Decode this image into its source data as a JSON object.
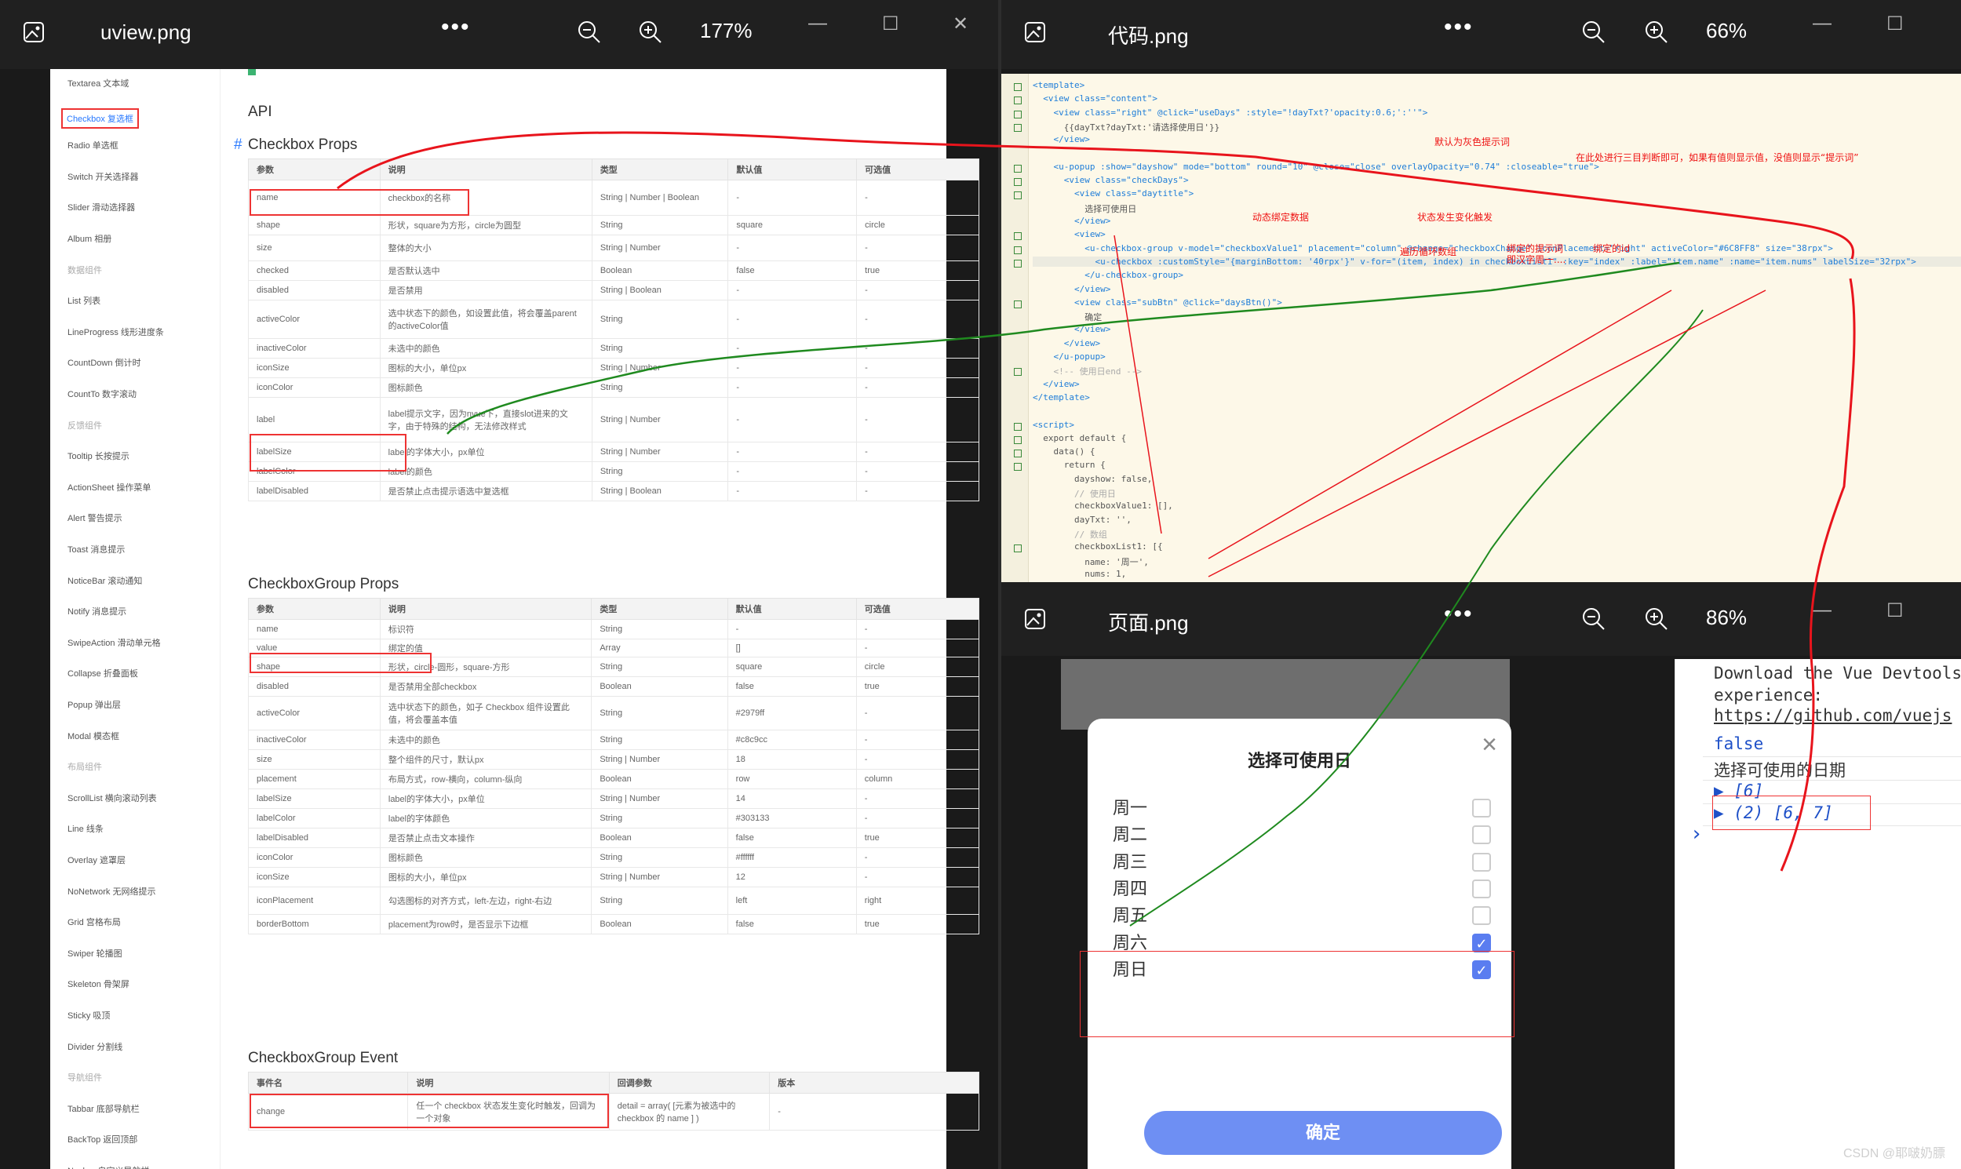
{
  "windows": {
    "uview": {
      "title": "uview.png",
      "zoom": "177%",
      "more": "•••"
    },
    "code": {
      "title": "代码.png",
      "zoom": "66%",
      "more": "•••"
    },
    "page": {
      "title": "页面.png",
      "zoom": "86%",
      "more": "•••"
    }
  },
  "uview_doc": {
    "sidebar": [
      {
        "label": "Textarea 文本域",
        "kind": "item"
      },
      {
        "label": "Checkbox 复选框",
        "kind": "active"
      },
      {
        "label": "Radio 单选框",
        "kind": "item"
      },
      {
        "label": "Switch 开关选择器",
        "kind": "item"
      },
      {
        "label": "Slider 滑动选择器",
        "kind": "item"
      },
      {
        "label": "Album 相册",
        "kind": "item"
      },
      {
        "label": "数据组件",
        "kind": "group"
      },
      {
        "label": "List 列表",
        "kind": "item"
      },
      {
        "label": "LineProgress 线形进度条",
        "kind": "item"
      },
      {
        "label": "CountDown 倒计时",
        "kind": "item"
      },
      {
        "label": "CountTo 数字滚动",
        "kind": "item"
      },
      {
        "label": "反馈组件",
        "kind": "group"
      },
      {
        "label": "Tooltip 长按提示",
        "kind": "item"
      },
      {
        "label": "ActionSheet 操作菜单",
        "kind": "item"
      },
      {
        "label": "Alert 警告提示",
        "kind": "item"
      },
      {
        "label": "Toast 消息提示",
        "kind": "item"
      },
      {
        "label": "NoticeBar 滚动通知",
        "kind": "item"
      },
      {
        "label": "Notify 消息提示",
        "kind": "item"
      },
      {
        "label": "SwipeAction 滑动单元格",
        "kind": "item"
      },
      {
        "label": "Collapse 折叠面板",
        "kind": "item"
      },
      {
        "label": "Popup 弹出层",
        "kind": "item"
      },
      {
        "label": "Modal 模态框",
        "kind": "item"
      },
      {
        "label": "布局组件",
        "kind": "group"
      },
      {
        "label": "ScrollList 横向滚动列表",
        "kind": "item"
      },
      {
        "label": "Line 线条",
        "kind": "item"
      },
      {
        "label": "Overlay 遮罩层",
        "kind": "item"
      },
      {
        "label": "NoNetwork 无网络提示",
        "kind": "item"
      },
      {
        "label": "Grid 宫格布局",
        "kind": "item"
      },
      {
        "label": "Swiper 轮播图",
        "kind": "item"
      },
      {
        "label": "Skeleton 骨架屏",
        "kind": "item"
      },
      {
        "label": "Sticky 吸顶",
        "kind": "item"
      },
      {
        "label": "Divider 分割线",
        "kind": "item"
      },
      {
        "label": "导航组件",
        "kind": "group"
      },
      {
        "label": "Tabbar 底部导航栏",
        "kind": "item"
      },
      {
        "label": "BackTop 返回顶部",
        "kind": "item"
      },
      {
        "label": "Navbar 自定义导航栏",
        "kind": "item"
      }
    ],
    "api_heading": "API",
    "hash": "#",
    "props_heading": "Checkbox Props",
    "group_props_heading": "CheckboxGroup Props",
    "event_heading": "CheckboxGroup Event",
    "headers": [
      "参数",
      "说明",
      "类型",
      "默认值",
      "可选值"
    ],
    "event_headers": [
      "事件名",
      "说明",
      "回调参数",
      "版本"
    ],
    "checkbox_props": [
      [
        "name",
        "checkbox的名称",
        "String | Number | Boolean",
        "-",
        "-"
      ],
      [
        "shape",
        "形状，square为方形，circle为圆型",
        "String",
        "square",
        "circle"
      ],
      [
        "size",
        "整体的大小",
        "String | Number",
        "-",
        "-"
      ],
      [
        "checked",
        "是否默认选中",
        "Boolean",
        "false",
        "true"
      ],
      [
        "disabled",
        "是否禁用",
        "String | Boolean",
        "-",
        "-"
      ],
      [
        "activeColor",
        "选中状态下的颜色，如设置此值，将会覆盖parent的activeColor值",
        "String",
        "-",
        "-"
      ],
      [
        "inactiveColor",
        "未选中的颜色",
        "String",
        "-",
        "-"
      ],
      [
        "iconSize",
        "图标的大小，单位px",
        "String | Number",
        "-",
        "-"
      ],
      [
        "iconColor",
        "图标颜色",
        "String",
        "-",
        "-"
      ],
      [
        "label",
        "label提示文字，因为nvue下，直接slot进来的文字，由于特殊的结构，无法修改样式",
        "String | Number",
        "-",
        "-"
      ],
      [
        "labelSize",
        "label的字体大小，px单位",
        "String | Number",
        "-",
        "-"
      ],
      [
        "labelColor",
        "label的颜色",
        "String",
        "-",
        "-"
      ],
      [
        "labelDisabled",
        "是否禁止点击提示语选中复选框",
        "String | Boolean",
        "-",
        "-"
      ]
    ],
    "group_props": [
      [
        "name",
        "标识符",
        "String",
        "-",
        "-"
      ],
      [
        "value",
        "绑定的值",
        "Array",
        "[]",
        "-"
      ],
      [
        "shape",
        "形状，circle-圆形，square-方形",
        "String",
        "square",
        "circle"
      ],
      [
        "disabled",
        "是否禁用全部checkbox",
        "Boolean",
        "false",
        "true"
      ],
      [
        "activeColor",
        "选中状态下的颜色，如子 Checkbox 组件设置此值，将会覆盖本值",
        "String",
        "#2979ff",
        "-"
      ],
      [
        "inactiveColor",
        "未选中的颜色",
        "String",
        "#c8c9cc",
        "-"
      ],
      [
        "size",
        "整个组件的尺寸，默认px",
        "String | Number",
        "18",
        "-"
      ],
      [
        "placement",
        "布局方式，row-横向，column-纵向",
        "Boolean",
        "row",
        "column"
      ],
      [
        "labelSize",
        "label的字体大小，px单位",
        "String | Number",
        "14",
        "-"
      ],
      [
        "labelColor",
        "label的字体颜色",
        "String",
        "#303133",
        "-"
      ],
      [
        "labelDisabled",
        "是否禁止点击文本操作",
        "Boolean",
        "false",
        "true"
      ],
      [
        "iconColor",
        "图标颜色",
        "String",
        "#ffffff",
        "-"
      ],
      [
        "iconSize",
        "图标的大小，单位px",
        "String | Number",
        "12",
        "-"
      ],
      [
        "iconPlacement",
        "勾选图标的对齐方式，left-左边，right-右边",
        "String",
        "left",
        "right"
      ],
      [
        "borderBottom",
        "placement为row时，是否显示下边框",
        "Boolean",
        "false",
        "true"
      ]
    ],
    "event_rows": [
      [
        "change",
        "任一个 checkbox 状态发生变化时触发，回调为一个对象",
        "detail = array( [元素为被选中的 checkbox 的 name ] )",
        "-"
      ]
    ]
  },
  "code_lines": [
    "<template>",
    "  <view class=\"content\">",
    "    <view class=\"right\" @click=\"useDays\" :style=\"!dayTxt?'opacity:0.6;':''\">",
    "      {{dayTxt?dayTxt:'请选择使用日'}}",
    "    </view>",
    "",
    "    <u-popup :show=\"dayshow\" mode=\"bottom\" round=\"10\" @close=\"close\" overlayOpacity=\"0.74\" :closeable=\"true\">",
    "      <view class=\"checkDays\">",
    "        <view class=\"daytitle\">",
    "          选择可使用日",
    "        </view>",
    "        <view>",
    "          <u-checkbox-group v-model=\"checkboxValue1\" placement=\"column\" @change=\"checkboxChange\" iconPlacement=\"right\" activeColor=\"#6C8FF8\" size=\"38rpx\">",
    "            <u-checkbox :customStyle=\"{marginBottom: '40rpx'}\" v-for=\"(item, index) in checkboxList1\" :key=\"index\" :label=\"item.name\" :name=\"item.nums\" labelSize=\"32rpx\">",
    "          </u-checkbox-group>",
    "        </view>",
    "        <view class=\"subBtn\" @click=\"daysBtn()\">",
    "          确定",
    "        </view>",
    "      </view>",
    "    </u-popup>",
    "    <!-- 使用日end -->",
    "  </view>",
    "</template>",
    "",
    "<script>",
    "  export default {",
    "    data() {",
    "      return {",
    "        dayshow: false,",
    "        // 使用日",
    "        checkboxValue1: [],",
    "        dayTxt: '',",
    "        // 数组",
    "        checkboxList1: [{",
    "          name: '周一',",
    "          nums: 1,"
  ],
  "code_annotations": {
    "default_grey": "默认为灰色提示词",
    "ternary": "在此处进行三目判断即可，如果有值则显示值，没值则显示“提示词”",
    "bind_data": "动态绑定数据",
    "state_change": "状态发生变化触发",
    "loop_array": "遍历循环数组",
    "bind_text": "绑定的提示词",
    "bind_text_2": "即汉字周一....",
    "bind_id": "绑定的id"
  },
  "page": {
    "popup_title": "选择可使用日",
    "close_glyph": "×",
    "days": [
      {
        "label": "周一",
        "checked": false
      },
      {
        "label": "周二",
        "checked": false
      },
      {
        "label": "周三",
        "checked": false
      },
      {
        "label": "周四",
        "checked": false
      },
      {
        "label": "周五",
        "checked": false
      },
      {
        "label": "周六",
        "checked": true
      },
      {
        "label": "周日",
        "checked": true
      }
    ],
    "confirm": "确定",
    "console_lines": [
      "Download the Vue Devtools",
      "experience:",
      "https://github.com/vuejs",
      "false",
      "选择可使用的日期",
      "▶ [6]",
      "▶ (2) [6, 7]",
      "›"
    ]
  },
  "watermark": "CSDN @耶啵奶膘",
  "colors": {
    "annotation_red": "#e33",
    "annotation_green": "#1f8a1f",
    "accent_blue": "#6e8ff3"
  }
}
